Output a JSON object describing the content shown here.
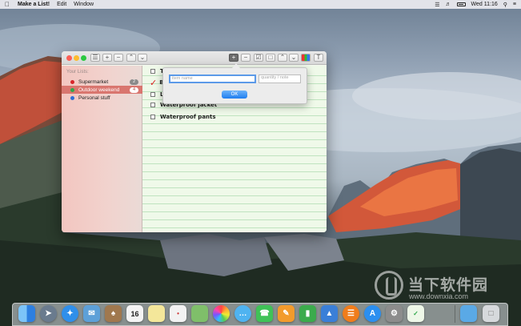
{
  "menubar": {
    "app_name": "Make a List!",
    "menus": [
      "Edit",
      "Window"
    ],
    "clock": "Wed 11:16",
    "icons": [
      "apple-icon",
      "wifi-icon",
      "volume-icon",
      "battery-icon",
      "search-icon",
      "menu-list-icon"
    ]
  },
  "window": {
    "toolbar_left": [
      "list-view-icon",
      "add-icon",
      "remove-icon",
      "chevron-up-icon",
      "chevron-down-icon"
    ],
    "toolbar_right": [
      "add-icon",
      "remove-icon",
      "checkbox-icon",
      "square-icon",
      "chevron-up-icon",
      "chevron-down-icon",
      "color-palette-icon",
      "text-icon"
    ]
  },
  "sidebar": {
    "heading": "Your Lists:",
    "items": [
      {
        "label": "Supermarket",
        "count": "2",
        "color": "#d8252a",
        "selected": false
      },
      {
        "label": "Outdoor weekend",
        "count": "4",
        "color": "#2fa84a",
        "selected": true
      },
      {
        "label": "Personal stuff",
        "count": "",
        "color": "#2d6fd6",
        "selected": false
      }
    ]
  },
  "items": [
    {
      "label": "T",
      "checked": false
    },
    {
      "label": "B",
      "checked": true
    },
    {
      "label": "L",
      "checked": false
    },
    {
      "label": "Waterproof jacket",
      "checked": false
    },
    {
      "label": "Waterproof pants",
      "checked": false
    }
  ],
  "popover": {
    "item_placeholder": "item name",
    "quantity_placeholder": "quantity / note",
    "ok_label": "OK"
  },
  "watermark": {
    "text": "当下软件园",
    "url": "www.downxia.com"
  },
  "dock": {
    "apps": [
      {
        "name": "finder-icon",
        "color": "#3a8de8"
      },
      {
        "name": "launchpad-icon",
        "color": "#6a7b8e"
      },
      {
        "name": "safari-icon",
        "color": "#2f8fea"
      },
      {
        "name": "mail-icon",
        "color": "#5da0d8"
      },
      {
        "name": "contacts-icon",
        "color": "#a0784e"
      },
      {
        "name": "calendar-icon",
        "color": "#f4f4f4"
      },
      {
        "name": "notes-icon",
        "color": "#f4e79a"
      },
      {
        "name": "reminders-icon",
        "color": "#f2f2f2"
      },
      {
        "name": "maps-icon",
        "color": "#7fbf6a"
      },
      {
        "name": "photos-icon",
        "color": "#f6f6f6"
      },
      {
        "name": "messages-icon",
        "color": "#4fb3f0"
      },
      {
        "name": "facetime-icon",
        "color": "#3fc257"
      },
      {
        "name": "pages-icon",
        "color": "#f29b2c"
      },
      {
        "name": "numbers-icon",
        "color": "#3bab4c"
      },
      {
        "name": "keynote-icon",
        "color": "#3a7fd8"
      },
      {
        "name": "ibooks-icon",
        "color": "#f07d1c"
      },
      {
        "name": "app-store-icon",
        "color": "#2b8ff0"
      },
      {
        "name": "system-preferences-icon",
        "color": "#8c8c8c"
      },
      {
        "name": "make-a-list-icon",
        "color": "#eef7e8"
      },
      {
        "name": "downloads-folder-icon",
        "color": "#5aa9e6"
      },
      {
        "name": "trash-icon",
        "color": "#d6d9dc"
      }
    ],
    "calendar_day": "16"
  }
}
